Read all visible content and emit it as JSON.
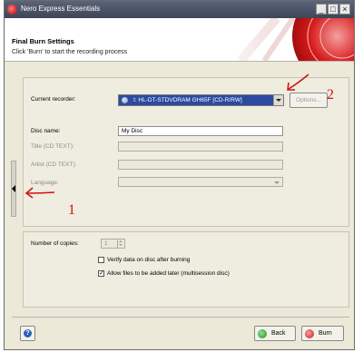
{
  "window": {
    "title": "Nero Express Essentials",
    "controls": [
      "_",
      "□",
      "×"
    ]
  },
  "header": {
    "title": "Final Burn Settings",
    "subtitle": "Click 'Burn' to start the recording process"
  },
  "form": {
    "recorder_label": "Current recorder:",
    "recorder_value": "I: HL-DT-STDVDRAM GH65F  [CD-R/RW]",
    "options_label": "Options...",
    "disc_name_label": "Disc name:",
    "disc_name_value": "My Disc",
    "title_label": "Title (CD TEXT):",
    "artist_label": "Artist (CD TEXT):",
    "language_label": "Language:",
    "copies_label": "Number of copies:",
    "copies_value": "1",
    "verify_label": "Verify data on disc after burning",
    "verify_checked": false,
    "allow_label": "Allow files to be added later (multisession disc)",
    "allow_checked": true
  },
  "footer": {
    "help_glyph": "?",
    "back_label": "Back",
    "burn_label": "Burn"
  },
  "annotations": {
    "marker_1": "1",
    "marker_2": "2",
    "color": "#d21010"
  },
  "icons": [
    "nero-logo-icon",
    "cd-drive-icon",
    "dropdown-arrow-icon",
    "collapse-arrow-icon",
    "help-icon",
    "back-icon",
    "burn-icon"
  ]
}
